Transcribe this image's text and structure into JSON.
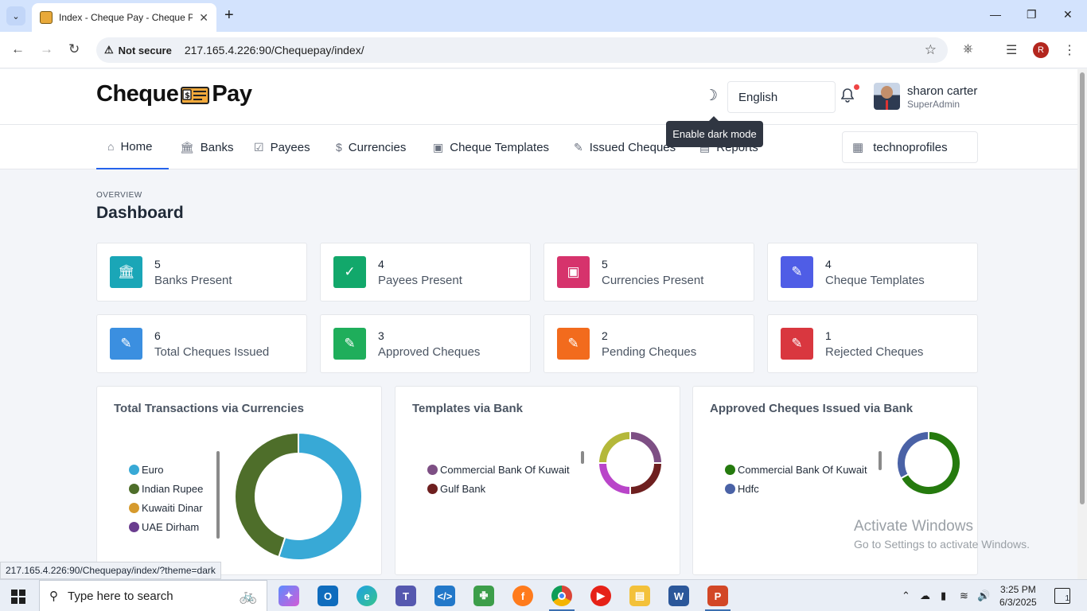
{
  "browser": {
    "tab_title": "Index - Cheque Pay - Cheque P",
    "security_label": "Not secure",
    "url": "217.165.4.226:90/Chequepay/index/",
    "profile_initial": "R",
    "status_url": "217.165.4.226:90/Chequepay/index/?theme=dark"
  },
  "header": {
    "logo_left": "Cheque",
    "logo_right": "Pay",
    "language": "English",
    "user_name": "sharon carter",
    "user_role": "SuperAdmin",
    "tooltip": "Enable dark mode"
  },
  "nav": {
    "items": [
      {
        "label": "Home",
        "icon": "home-icon"
      },
      {
        "label": "Banks",
        "icon": "bank-icon"
      },
      {
        "label": "Payees",
        "icon": "check-square-icon"
      },
      {
        "label": "Currencies",
        "icon": "dollar-icon"
      },
      {
        "label": "Cheque Templates",
        "icon": "banknote-icon"
      },
      {
        "label": "Issued Cheques",
        "icon": "pencil-icon"
      },
      {
        "label": "Reports",
        "icon": "report-icon"
      }
    ],
    "organization": "technoprofiles"
  },
  "main": {
    "overview": "OVERVIEW",
    "title": "Dashboard"
  },
  "stats": [
    {
      "value": "5",
      "label": "Banks Present",
      "color": "#1aa6b7"
    },
    {
      "value": "4",
      "label": "Payees Present",
      "color": "#12a86b"
    },
    {
      "value": "5",
      "label": "Currencies Present",
      "color": "#d6336c"
    },
    {
      "value": "4",
      "label": "Cheque Templates",
      "color": "#4f5de6"
    },
    {
      "value": "6",
      "label": "Total Cheques Issued",
      "color": "#3b8fe0"
    },
    {
      "value": "3",
      "label": "Approved Cheques",
      "color": "#1fae5b"
    },
    {
      "value": "2",
      "label": "Pending Cheques",
      "color": "#f26b1d"
    },
    {
      "value": "1",
      "label": "Rejected Cheques",
      "color": "#d9373f"
    }
  ],
  "chart_data": [
    {
      "type": "pie",
      "title": "Total Transactions via Currencies",
      "legend": [
        "Euro",
        "Indian Rupee",
        "Kuwaiti Dinar",
        "UAE Dirham"
      ],
      "colors": [
        "#38a9d6",
        "#4e6e2a",
        "#d69a2d",
        "#6a3d8f"
      ],
      "values": [
        55,
        45,
        0,
        0
      ]
    },
    {
      "type": "pie",
      "title": "Templates via Bank",
      "legend": [
        "Commercial Bank Of Kuwait",
        "Gulf Bank"
      ],
      "colors": [
        "#7d4f84",
        "#6e1f1f",
        "#b945c9",
        "#b4b83a"
      ],
      "values": [
        25,
        25,
        25,
        25
      ]
    },
    {
      "type": "pie",
      "title": "Approved Cheques Issued via Bank",
      "legend": [
        "Commercial Bank Of Kuwait",
        "Hdfc"
      ],
      "colors": [
        "#257a0e",
        "#4a62a6"
      ],
      "values": [
        67,
        33
      ]
    }
  ],
  "watermark": {
    "line1": "Activate Windows",
    "line2": "Go to Settings to activate Windows."
  },
  "taskbar": {
    "search_placeholder": "Type here to search",
    "time": "3:25 PM",
    "date": "6/3/2025",
    "notifications": "1"
  }
}
